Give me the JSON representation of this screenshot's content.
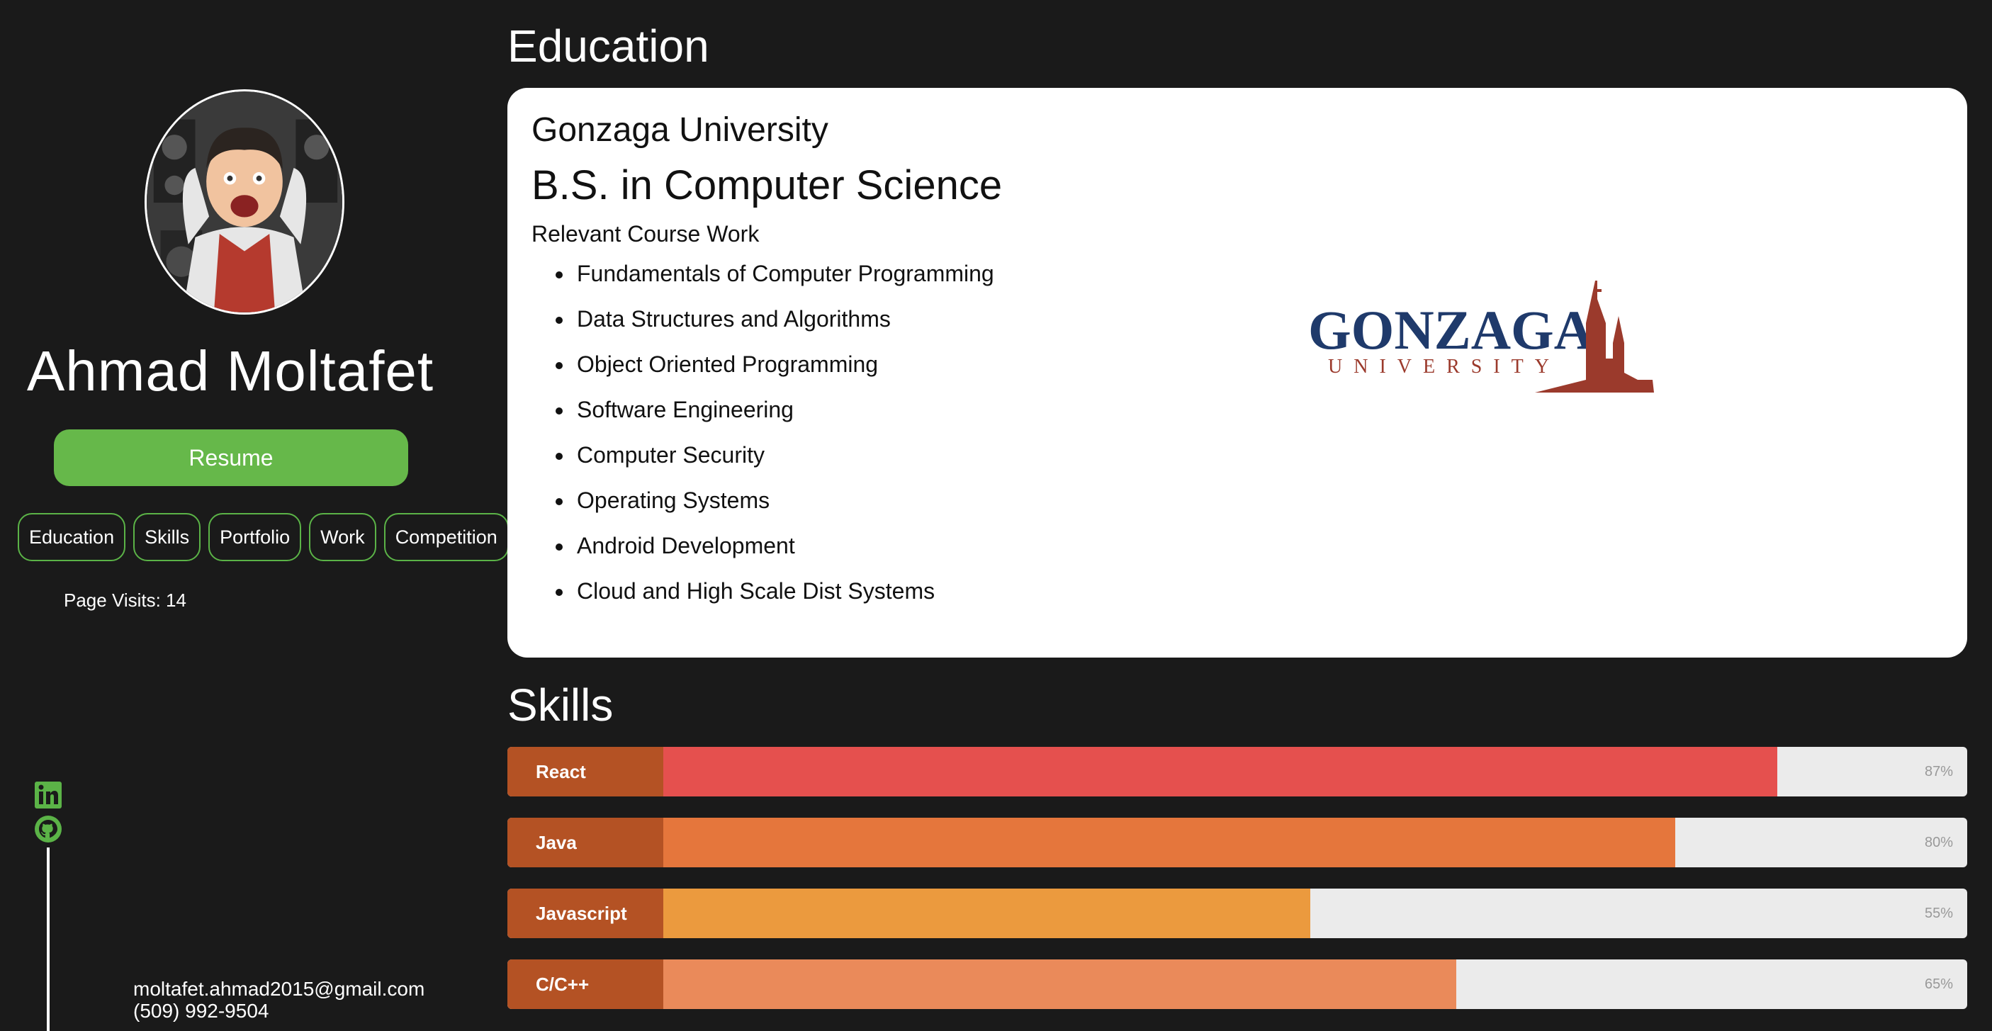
{
  "profile": {
    "name": "Ahmad Moltafet",
    "resume_label": "Resume",
    "page_visits": "Page Visits: 14",
    "email": "moltafet.ahmad2015@gmail.com",
    "phone": "(509) 992-9504",
    "social_icons": [
      "linkedin-icon",
      "github-icon"
    ]
  },
  "nav": {
    "items": [
      "Education",
      "Skills",
      "Portfolio",
      "Work",
      "Competition"
    ]
  },
  "education": {
    "heading": "Education",
    "school": "Gonzaga University",
    "degree": "B.S. in Computer Science",
    "coursework_heading": "Relevant Course Work",
    "courses": [
      "Fundamentals of Computer Programming",
      "Data Structures and Algorithms",
      "Object Oriented Programming",
      "Software Engineering",
      "Computer Security",
      "Operating Systems",
      "Android Development",
      "Cloud and High Scale Dist Systems"
    ],
    "logo": {
      "word1": "GONZAGA",
      "word2": "UNIVERSITY",
      "primary_color": "#1f3a6b",
      "secondary_color": "#9b3a2c"
    }
  },
  "skills": {
    "heading": "Skills",
    "items": [
      {
        "name": "React",
        "percent": 87,
        "label": "87%",
        "color": "#e5504e"
      },
      {
        "name": "Java",
        "percent": 80,
        "label": "80%",
        "color": "#e5763c"
      },
      {
        "name": "Javascript",
        "percent": 55,
        "label": "55%",
        "color": "#eb9a3e"
      },
      {
        "name": "C/C++",
        "percent": 65,
        "label": "65%",
        "color": "#ea8a5a"
      }
    ]
  },
  "theme": {
    "background": "#1a1a1a",
    "accent_green": "#66b84a",
    "skill_label_bg": "#b45224"
  }
}
